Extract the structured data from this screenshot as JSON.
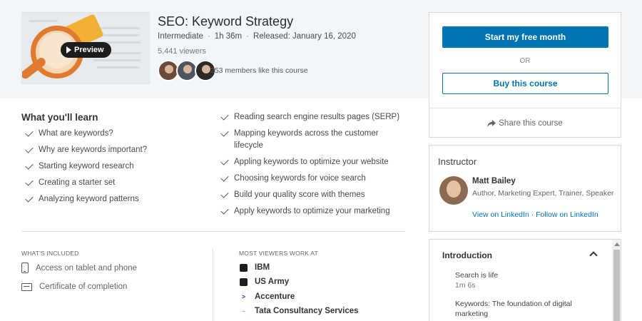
{
  "thumbnail": {
    "preview_label": "Preview"
  },
  "course": {
    "title": "SEO: Keyword Strategy",
    "level": "Intermediate",
    "duration": "1h 36m",
    "released": "Released: January 16, 2020",
    "viewers": "5,441 viewers",
    "members_count": "253 members",
    "members_suffix": " like this course"
  },
  "purchase": {
    "primary_button": "Start my free month",
    "or_label": "OR",
    "buy_button": "Buy this course",
    "share_label": "Share this course"
  },
  "learn": {
    "title": "What you'll learn",
    "col1": [
      "What are keywords?",
      "Why are keywords important?",
      "Starting keyword research",
      "Creating a starter set",
      "Analyzing keyword patterns"
    ],
    "col2": [
      "Reading search engine results pages (SERP)",
      "Mapping keywords across the customer lifecycle",
      "Appling keywords to optimize your website",
      "Choosing keywords for voice search",
      "Build your quality score with themes",
      "Apply keywords to optimize your marketing"
    ]
  },
  "included": {
    "heading": "WHAT'S INCLUDED",
    "items": [
      "Access on tablet and phone",
      "Certificate of completion"
    ]
  },
  "viewers_work": {
    "heading": "MOST VIEWERS WORK AT",
    "companies": [
      "IBM",
      "US Army",
      "Accenture",
      "Tata Consultancy Services"
    ]
  },
  "instructor": {
    "heading": "Instructor",
    "name": "Matt Bailey",
    "role": "Author, Marketing Expert, Trainer, Speaker",
    "link_view": "View on LinkedIn",
    "link_sep": " · ",
    "link_follow": "Follow on LinkedIn"
  },
  "contents": {
    "section": "Introduction",
    "items": [
      {
        "title": "Search is life",
        "duration": "1m 6s"
      },
      {
        "title": "Keywords: The foundation of digital marketing",
        "duration": ""
      }
    ]
  },
  "colors": {
    "accent": "#0073b1",
    "hero_bg": "#f3f6f8",
    "accenture": "#a100ff"
  }
}
